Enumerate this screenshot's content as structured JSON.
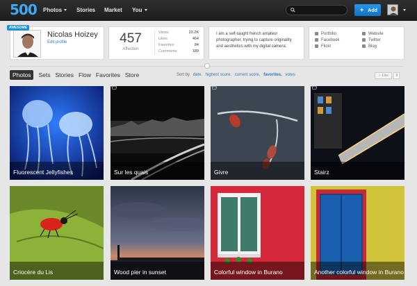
{
  "nav": {
    "logo": "500",
    "items": [
      {
        "label": "Photos",
        "dropdown": true
      },
      {
        "label": "Stories",
        "dropdown": false
      },
      {
        "label": "Market",
        "dropdown": false
      },
      {
        "label": "You",
        "dropdown": true
      }
    ],
    "search_placeholder": "",
    "add_label": "Add"
  },
  "profile": {
    "badge": "AWESOME",
    "name": "Nicolas Hoizey",
    "edit_label": "Edit profile",
    "affection_value": "457",
    "affection_label": "Affection",
    "stats": [
      {
        "label": "Views",
        "value": "23.2K"
      },
      {
        "label": "Likes",
        "value": "464"
      },
      {
        "label": "Favorites",
        "value": "84"
      },
      {
        "label": "Comments",
        "value": "189"
      }
    ],
    "bio": "I am a self-taught french amateur photographer, trying to capture originality and aesthetics with my digital camera.",
    "links_left": [
      {
        "label": "Portfolio",
        "icon": "portfolio-icon"
      },
      {
        "label": "Facebook",
        "icon": "facebook-icon"
      },
      {
        "label": "Flickr",
        "icon": "flickr-icon"
      }
    ],
    "links_right": [
      {
        "label": "Website",
        "icon": "website-icon"
      },
      {
        "label": "Twitter",
        "icon": "twitter-icon"
      },
      {
        "label": "Blog",
        "icon": "blog-icon"
      }
    ]
  },
  "tabs": [
    "Photos",
    "Sets",
    "Stories",
    "Flow",
    "Favorites",
    "Store"
  ],
  "active_tab": "Photos",
  "sort": {
    "label": "Sort by",
    "options": [
      "date,",
      "highest score,",
      "current score,",
      "favorites,",
      "votes"
    ],
    "selected": "favorites,"
  },
  "like": {
    "label": "Like",
    "count": "3"
  },
  "photos": [
    {
      "title": "Fluorescent Jellyfishes",
      "cart": false
    },
    {
      "title": "Sur les quais",
      "cart": true
    },
    {
      "title": "Givre",
      "cart": true
    },
    {
      "title": "Stairz",
      "cart": true
    },
    {
      "title": "Criocère du Lis",
      "cart": false
    },
    {
      "title": "Wood pier in sunset",
      "cart": false
    },
    {
      "title": "Colorful window in Burano",
      "cart": false
    },
    {
      "title": "Another colorful window in Burano",
      "cart": false
    }
  ],
  "colors": {
    "accent": "#1a8ee0",
    "link": "#2b7bc4",
    "topbar": "#252525"
  }
}
